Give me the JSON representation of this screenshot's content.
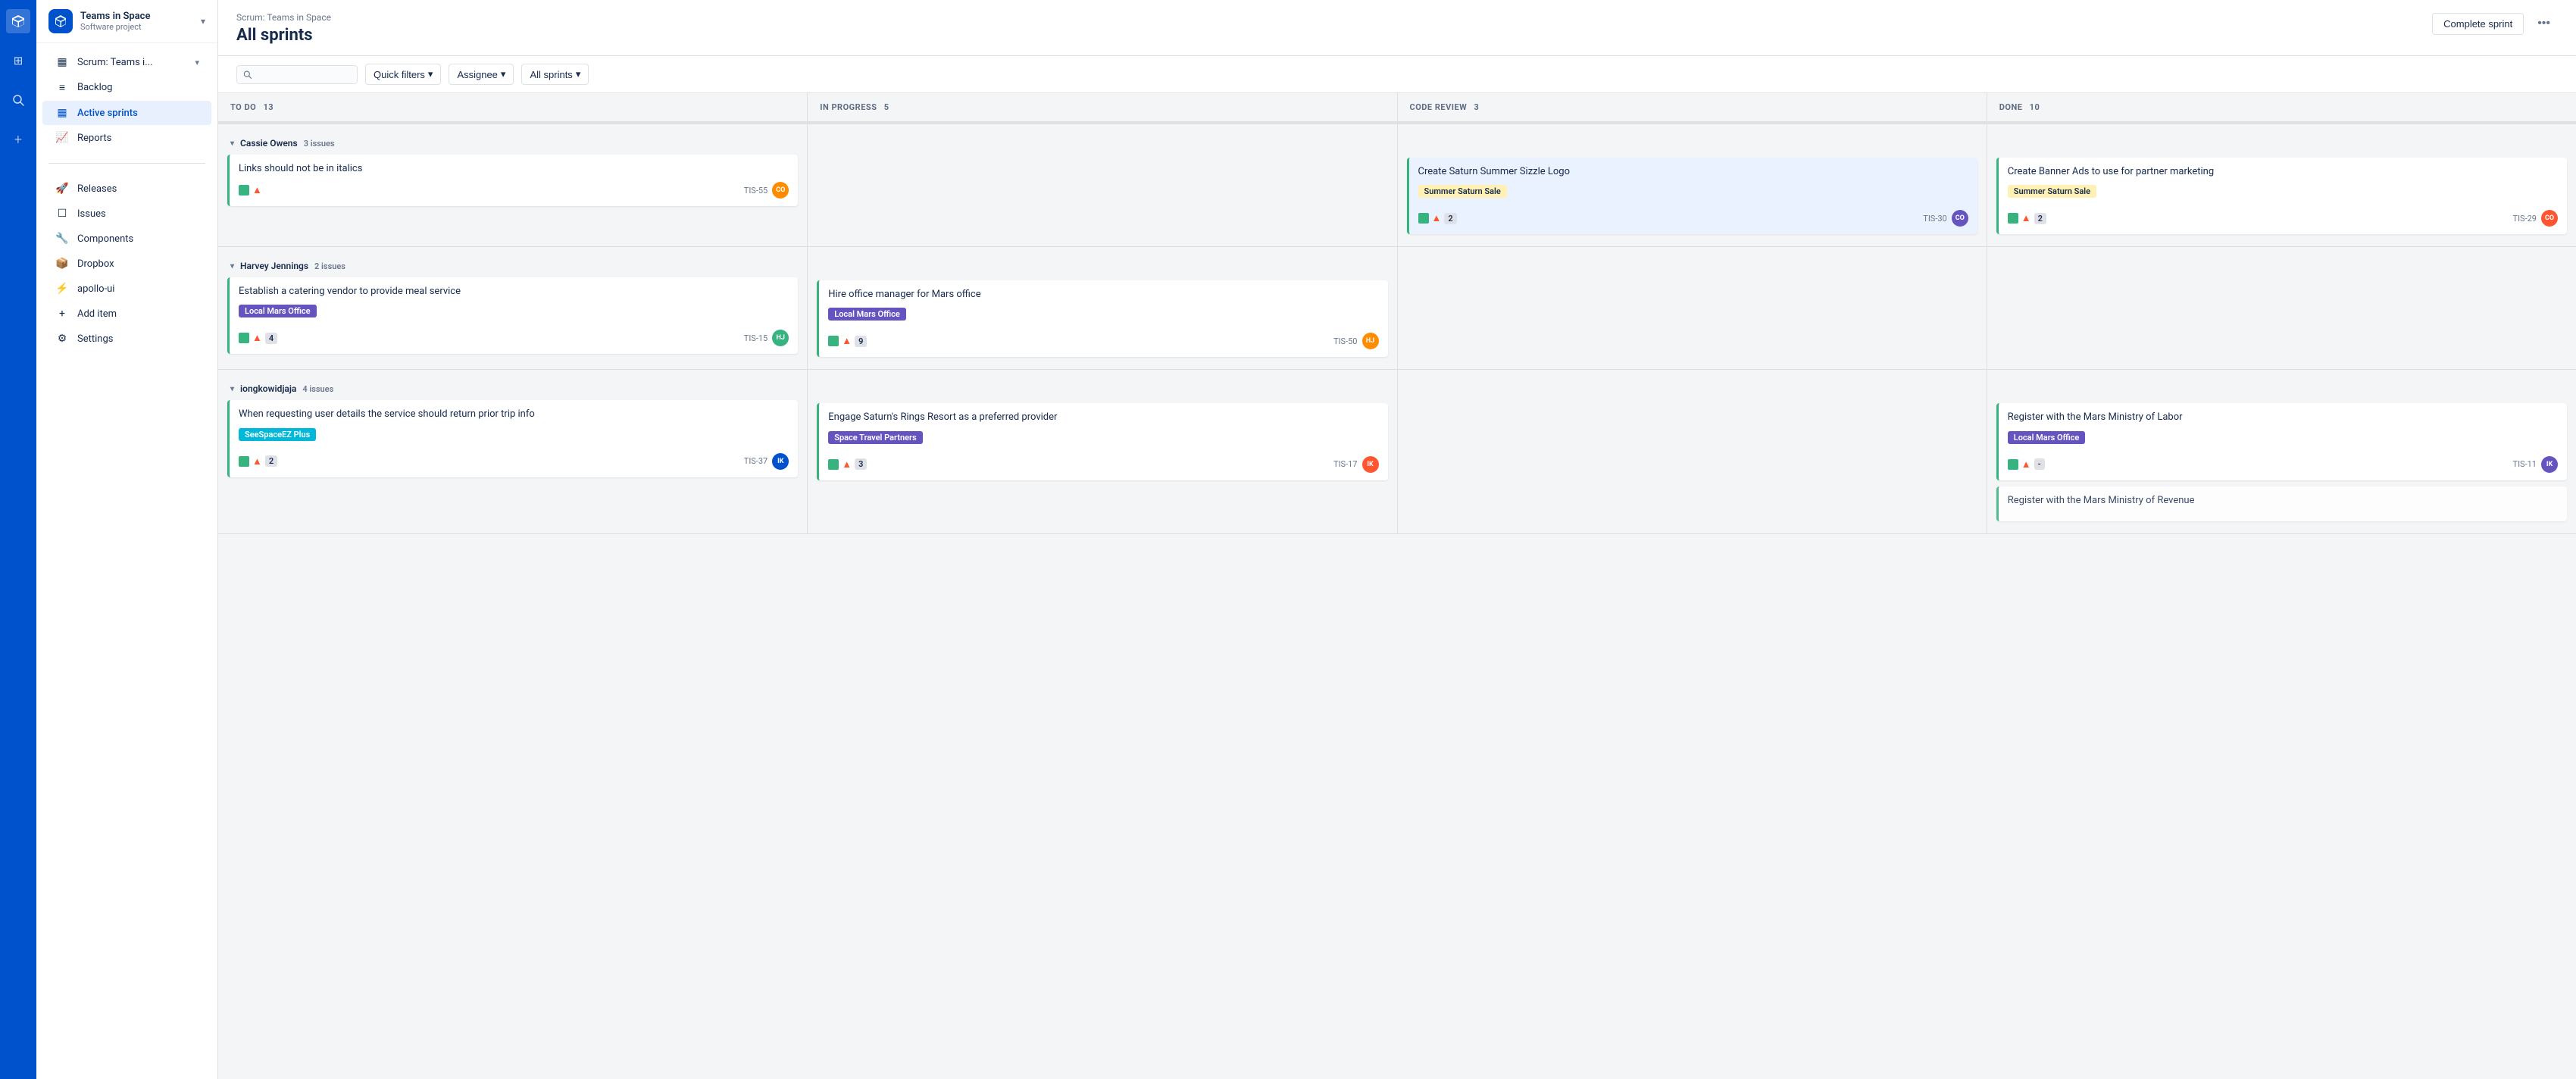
{
  "iconBar": {
    "logo": "◆",
    "home": "⊞",
    "search": "🔍",
    "add": "+"
  },
  "sidebar": {
    "projectTitle": "Teams in Space",
    "projectSubtitle": "Software project",
    "items": [
      {
        "id": "scrum",
        "label": "Scrum: Teams i...",
        "icon": "▦",
        "hasChevron": true,
        "active": false
      },
      {
        "id": "backlog",
        "label": "Backlog",
        "icon": "≡",
        "active": false
      },
      {
        "id": "active-sprints",
        "label": "Active sprints",
        "icon": "▦",
        "active": true
      },
      {
        "id": "reports",
        "label": "Reports",
        "icon": "📈",
        "active": false
      }
    ],
    "bottomItems": [
      {
        "id": "releases",
        "label": "Releases",
        "icon": "🚀"
      },
      {
        "id": "issues",
        "label": "Issues",
        "icon": "☐"
      },
      {
        "id": "components",
        "label": "Components",
        "icon": "🔧"
      },
      {
        "id": "dropbox",
        "label": "Dropbox",
        "icon": "📦"
      },
      {
        "id": "apollo-ui",
        "label": "apollo-ui",
        "icon": "⚡"
      },
      {
        "id": "add-item",
        "label": "Add item",
        "icon": "+"
      },
      {
        "id": "settings",
        "label": "Settings",
        "icon": "⚙"
      }
    ]
  },
  "header": {
    "breadcrumb": "Scrum: Teams in Space",
    "title": "All sprints",
    "completeSprint": "Complete sprint",
    "moreIcon": "•••"
  },
  "toolbar": {
    "searchPlaceholder": "",
    "quickFilters": "Quick filters",
    "assignee": "Assignee",
    "allSprints": "All sprints",
    "chevron": "▾"
  },
  "columns": [
    {
      "id": "todo",
      "label": "TO DO",
      "count": 13
    },
    {
      "id": "inprogress",
      "label": "IN PROGRESS",
      "count": 5
    },
    {
      "id": "codereview",
      "label": "CODE REVIEW",
      "count": 3
    },
    {
      "id": "done",
      "label": "DONE",
      "count": 10
    }
  ],
  "swimlanes": [
    {
      "id": "cassie",
      "name": "Cassie Owens",
      "issueCount": "3 issues",
      "cards": {
        "todo": [
          {
            "title": "Links should not be in italics",
            "tag": null,
            "icons": [
              "story",
              "priority-high"
            ],
            "count": null,
            "id": "TIS-55",
            "avatarColor": "#FF8B00",
            "avatarInitials": "CO",
            "borderColor": "green"
          }
        ],
        "inprogress": [],
        "codereview": [
          {
            "title": "Create Saturn Summer Sizzle Logo",
            "tag": "Summer Saturn Sale",
            "tagStyle": "yellow",
            "icons": [
              "story",
              "priority-high"
            ],
            "count": "2",
            "id": "TIS-30",
            "avatarColor": "#6554C0",
            "avatarInitials": "CO",
            "borderColor": "green",
            "highlighted": true
          }
        ],
        "done": [
          {
            "title": "Create Banner Ads to use for partner marketing",
            "tag": "Summer Saturn Sale",
            "tagStyle": "yellow",
            "icons": [
              "story",
              "priority-high"
            ],
            "count": "2",
            "id": "TIS-29",
            "avatarColor": "#FF5630",
            "avatarInitials": "CO",
            "borderColor": "green"
          }
        ]
      }
    },
    {
      "id": "harvey",
      "name": "Harvey Jennings",
      "issueCount": "2 issues",
      "cards": {
        "todo": [
          {
            "title": "Establish a catering vendor to provide meal service",
            "tag": "Local Mars Office",
            "tagStyle": "purple",
            "icons": [
              "story",
              "priority-high"
            ],
            "count": "4",
            "id": "TIS-15",
            "avatarColor": "#36B37E",
            "avatarInitials": "HJ",
            "borderColor": "green"
          }
        ],
        "inprogress": [
          {
            "title": "Hire office manager for Mars office",
            "tag": "Local Mars Office",
            "tagStyle": "green",
            "icons": [
              "story",
              "priority-high"
            ],
            "count": "9",
            "id": "TIS-50",
            "avatarColor": "#FF8B00",
            "avatarInitials": "HJ",
            "borderColor": "green"
          }
        ],
        "codereview": [],
        "done": []
      }
    },
    {
      "id": "iong",
      "name": "iongkowidjaja",
      "issueCount": "4 issues",
      "cards": {
        "todo": [
          {
            "title": "When requesting user details the service should return prior trip info",
            "tag": "SeeSpaceEZ Plus",
            "tagStyle": "cyan",
            "icons": [
              "story",
              "priority-high"
            ],
            "count": "2",
            "id": "TIS-37",
            "avatarColor": "#0052CC",
            "avatarInitials": "IK",
            "borderColor": "green"
          }
        ],
        "inprogress": [
          {
            "title": "Engage Saturn's Rings Resort as a preferred provider",
            "tag": "Space Travel Partners",
            "tagStyle": "teal",
            "icons": [
              "story",
              "priority-high"
            ],
            "count": "3",
            "id": "TIS-17",
            "avatarColor": "#FF5630",
            "avatarInitials": "IK",
            "borderColor": "green"
          }
        ],
        "codereview": [],
        "done": [
          {
            "title": "Register with the Mars Ministry of Labor",
            "tag": "Local Mars Office",
            "tagStyle": "purple",
            "icons": [
              "story",
              "priority-high"
            ],
            "count": "-",
            "id": "TIS-11",
            "avatarColor": "#6554C0",
            "avatarInitials": "IK",
            "borderColor": "green"
          },
          {
            "title": "Register with the Mars Ministry of Revenue",
            "tag": null,
            "icons": [],
            "count": null,
            "id": "",
            "avatarColor": null,
            "avatarInitials": "",
            "borderColor": "green",
            "partial": true
          }
        ]
      }
    }
  ],
  "colors": {
    "accent": "#0052CC",
    "activeNav": "#E8F0FE",
    "tagYellow": "#FFF0B3",
    "tagPurple": "#6554C0",
    "tagGreen": "#36B37E",
    "tagTeal": "#00B8D9",
    "tagCyan": "#79E2F2"
  }
}
